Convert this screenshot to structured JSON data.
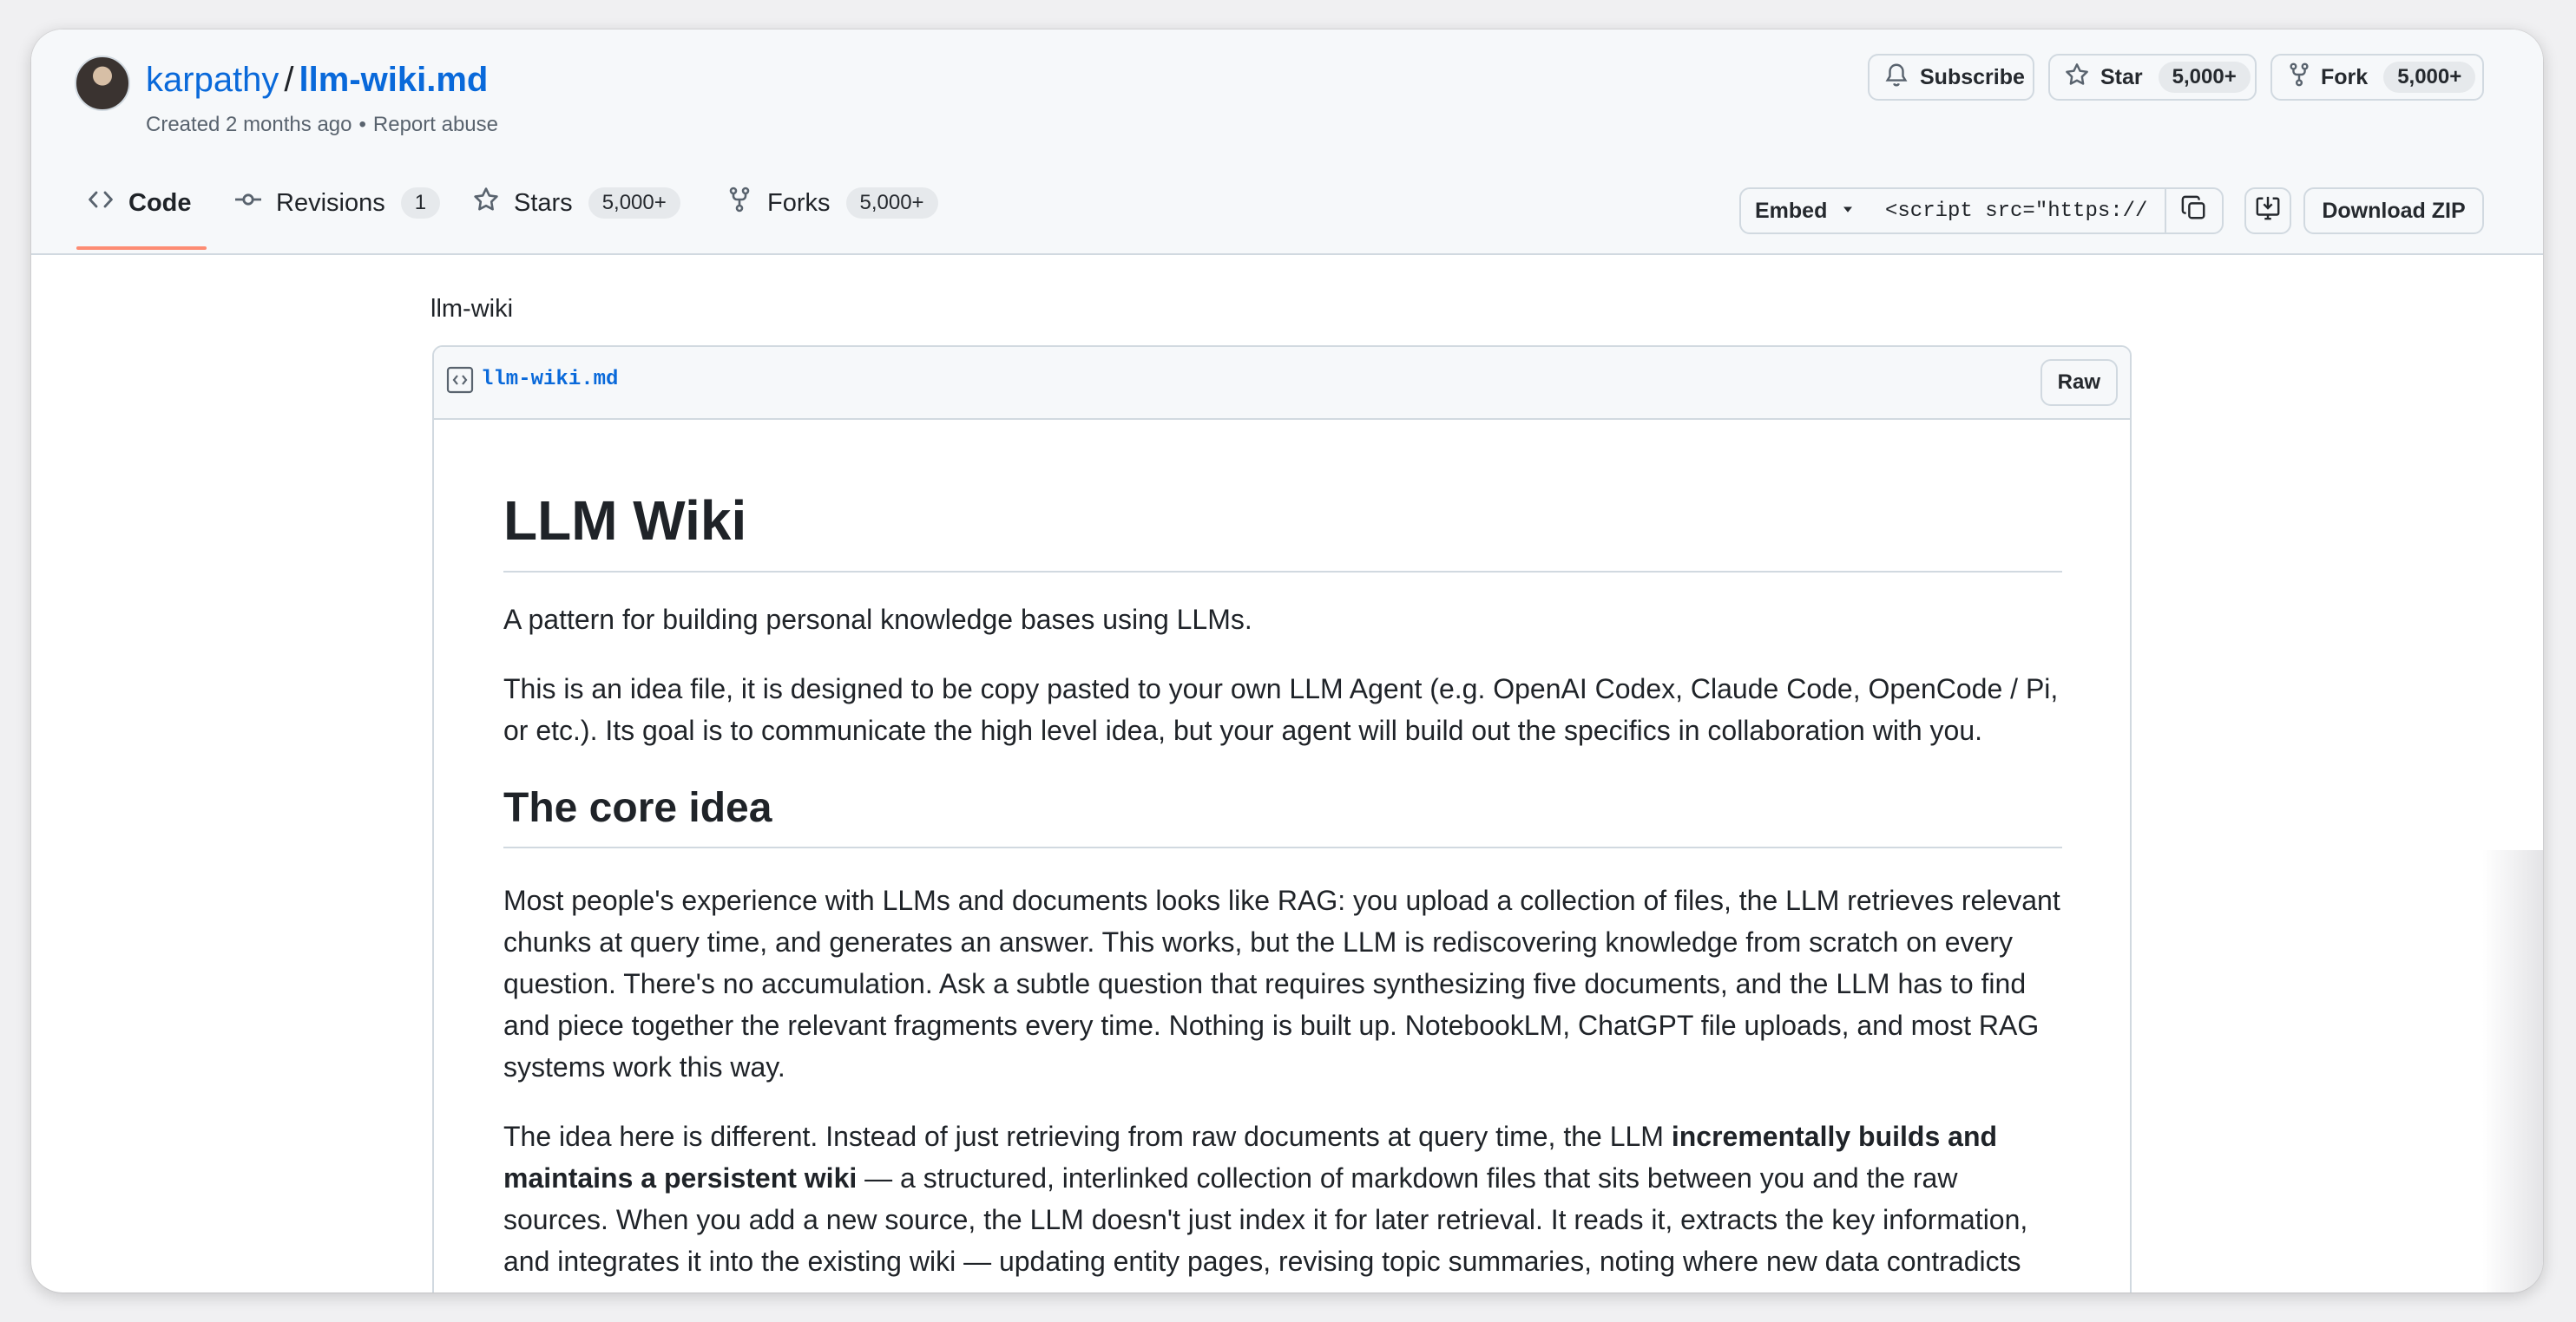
{
  "gist": {
    "owner": "karpathy",
    "separator": "/",
    "filename": "llm-wiki.md",
    "created": "Created 2 months ago",
    "dot": "•",
    "report": "Report abuse"
  },
  "actions": {
    "subscribe": "Subscribe",
    "star": "Star",
    "star_count": "5,000+",
    "fork": "Fork",
    "fork_count": "5,000+"
  },
  "tabs": [
    {
      "label": "Code",
      "active": true,
      "icon": "code-icon"
    },
    {
      "label": "Revisions",
      "count": "1",
      "icon": "commit-icon"
    },
    {
      "label": "Stars",
      "count": "5,000+",
      "icon": "star-icon"
    },
    {
      "label": "Forks",
      "count": "5,000+",
      "icon": "fork-icon"
    }
  ],
  "toolbar": {
    "embed": "Embed",
    "embed_code": "<script src=\"https://",
    "download": "Download ZIP"
  },
  "file": {
    "description": "llm-wiki",
    "name": "llm-wiki.md",
    "raw": "Raw"
  },
  "content": {
    "h1": "LLM Wiki",
    "p1": "A pattern for building personal knowledge bases using LLMs.",
    "p2": "This is an idea file, it is designed to be copy pasted to your own LLM Agent (e.g. OpenAI Codex, Claude Code, OpenCode / Pi, or etc.). Its goal is to communicate the high level idea, but your agent will build out the specifics in collaboration with you.",
    "h2": "The core idea",
    "p3": "Most people's experience with LLMs and documents looks like RAG: you upload a collection of files, the LLM retrieves relevant chunks at query time, and generates an answer. This works, but the LLM is rediscovering knowledge from scratch on every question. There's no accumulation. Ask a subtle question that requires synthesizing five documents, and the LLM has to find and piece together the relevant fragments every time. Nothing is built up. NotebookLM, ChatGPT file uploads, and most RAG systems work this way.",
    "p4_a": "The idea here is different. Instead of just retrieving from raw documents at query time, the LLM ",
    "p4_b": "incrementally builds and maintains a persistent wiki",
    "p4_c": " — a structured, interlinked collection of markdown files that sits between you and the raw sources. When you add a new source, the LLM doesn't just index it for later retrieval. It reads it, extracts the key information, and integrates it into the existing wiki — updating entity pages, revising topic summaries, noting where new data contradicts"
  },
  "colors": {
    "link": "#0969da",
    "tab_underline": "#fd8c73",
    "header_bg": "#f6f8fa",
    "border": "#d1d9e0"
  }
}
